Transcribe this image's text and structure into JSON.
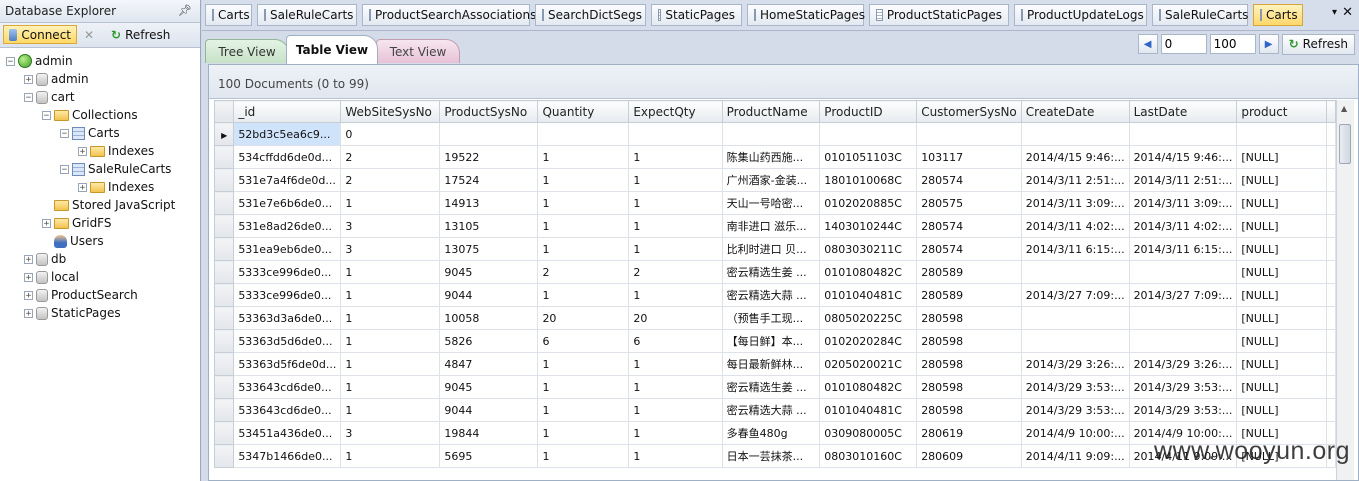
{
  "explorer": {
    "title": "Database Explorer",
    "connect_label": "Connect",
    "refresh_label": "Refresh",
    "tree": [
      {
        "label": "admin",
        "icon": "globe-icon",
        "level": 0,
        "expanded": true
      },
      {
        "label": "admin",
        "icon": "database-icon",
        "level": 1,
        "expanded": false
      },
      {
        "label": "cart",
        "icon": "database-icon",
        "level": 1,
        "expanded": true
      },
      {
        "label": "Collections",
        "icon": "folder-icon",
        "level": 2,
        "expanded": true
      },
      {
        "label": "Carts",
        "icon": "table-icon",
        "level": 3,
        "expanded": true
      },
      {
        "label": "Indexes",
        "icon": "folder-icon",
        "level": 4,
        "expanded": false
      },
      {
        "label": "SaleRuleCarts",
        "icon": "table-icon",
        "level": 3,
        "expanded": true
      },
      {
        "label": "Indexes",
        "icon": "folder-icon",
        "level": 4,
        "expanded": false
      },
      {
        "label": "Stored JavaScript",
        "icon": "folder-icon",
        "level": 2,
        "expanded": null
      },
      {
        "label": "GridFS",
        "icon": "folder-icon",
        "level": 2,
        "expanded": false
      },
      {
        "label": "Users",
        "icon": "user-icon",
        "level": 2,
        "expanded": null
      },
      {
        "label": "db",
        "icon": "database-icon",
        "level": 1,
        "expanded": false
      },
      {
        "label": "local",
        "icon": "database-icon",
        "level": 1,
        "expanded": false
      },
      {
        "label": "ProductSearch",
        "icon": "database-icon",
        "level": 1,
        "expanded": false
      },
      {
        "label": "StaticPages",
        "icon": "database-icon",
        "level": 1,
        "expanded": false
      }
    ]
  },
  "collection_tabs": [
    {
      "label": "Carts",
      "active": false
    },
    {
      "label": "SaleRuleCarts",
      "active": false
    },
    {
      "label": "ProductSearchAssociations",
      "active": false
    },
    {
      "label": "SearchDictSegs",
      "active": false
    },
    {
      "label": "StaticPages",
      "active": false
    },
    {
      "label": "HomeStaticPages",
      "active": false
    },
    {
      "label": "ProductStaticPages",
      "active": false
    },
    {
      "label": "ProductUpdateLogs",
      "active": false
    },
    {
      "label": "SaleRuleCarts",
      "active": false
    },
    {
      "label": "Carts",
      "active": true
    }
  ],
  "view_tabs": {
    "tree": "Tree View",
    "table": "Table View",
    "text": "Text View",
    "active": "table"
  },
  "pager": {
    "skip": "0",
    "limit": "100",
    "refresh_label": "Refresh"
  },
  "doc_count": "100 Documents (0 to 99)",
  "columns": [
    "_id",
    "WebSiteSysNo",
    "ProductSysNo",
    "Quantity",
    "ExpectQty",
    "ProductName",
    "ProductID",
    "CustomerSysNo",
    "CreateDate",
    "LastDate",
    "product"
  ],
  "rows": [
    [
      "52bd3c5ea6c9...",
      "0",
      "",
      "",
      "",
      "",
      "",
      "",
      "",
      "",
      ""
    ],
    [
      "534cffdd6de0d...",
      "2",
      "19522",
      "1",
      "1",
      "陈集山药西施...",
      "0101051103C",
      "103117",
      "2014/4/15 9:46:...",
      "2014/4/15 9:46:...",
      "[NULL]"
    ],
    [
      "531e7a4f6de0d...",
      "2",
      "17524",
      "1",
      "1",
      "广州酒家-金装...",
      "1801010068C",
      "280574",
      "2014/3/11 2:51:...",
      "2014/3/11 2:51:...",
      "[NULL]"
    ],
    [
      "531e7e6b6de0...",
      "1",
      "14913",
      "1",
      "1",
      "天山一号哈密...",
      "0102020885C",
      "280575",
      "2014/3/11 3:09:...",
      "2014/3/11 3:09:...",
      "[NULL]"
    ],
    [
      "531e8ad26de0...",
      "3",
      "13105",
      "1",
      "1",
      "南非进口 滋乐...",
      "1403010244C",
      "280574",
      "2014/3/11 4:02:...",
      "2014/3/11 4:02:...",
      "[NULL]"
    ],
    [
      "531ea9eb6de0...",
      "3",
      "13075",
      "1",
      "1",
      "比利时进口 贝...",
      "0803030211C",
      "280574",
      "2014/3/11 6:15:...",
      "2014/3/11 6:15:...",
      "[NULL]"
    ],
    [
      "5333ce996de0...",
      "1",
      "9045",
      "2",
      "2",
      "密云精选生姜 ...",
      "0101080482C",
      "280589",
      "",
      "",
      "[NULL]"
    ],
    [
      "5333ce996de0...",
      "1",
      "9044",
      "1",
      "1",
      "密云精选大蒜 ...",
      "0101040481C",
      "280589",
      "2014/3/27 7:09:...",
      "2014/3/27 7:09:...",
      "[NULL]"
    ],
    [
      "53363d3a6de0...",
      "1",
      "10058",
      "20",
      "20",
      "（预售手工现...",
      "0805020225C",
      "280598",
      "",
      "",
      "[NULL]"
    ],
    [
      "53363d5d6de0...",
      "1",
      "5826",
      "6",
      "6",
      "【每日鲜】本...",
      "0102020284C",
      "280598",
      "",
      "",
      "[NULL]"
    ],
    [
      "53363d5f6de0d...",
      "1",
      "4847",
      "1",
      "1",
      "每日最新鲜林...",
      "0205020021C",
      "280598",
      "2014/3/29 3:26:...",
      "2014/3/29 3:26:...",
      "[NULL]"
    ],
    [
      "533643cd6de0...",
      "1",
      "9045",
      "1",
      "1",
      "密云精选生姜 ...",
      "0101080482C",
      "280598",
      "2014/3/29 3:53:...",
      "2014/3/29 3:53:...",
      "[NULL]"
    ],
    [
      "533643cd6de0...",
      "1",
      "9044",
      "1",
      "1",
      "密云精选大蒜 ...",
      "0101040481C",
      "280598",
      "2014/3/29 3:53:...",
      "2014/3/29 3:53:...",
      "[NULL]"
    ],
    [
      "53451a436de0...",
      "3",
      "19844",
      "1",
      "1",
      "多春鱼480g",
      "0309080005C",
      "280619",
      "2014/4/9 10:00:...",
      "2014/4/9 10:00:...",
      "[NULL]"
    ],
    [
      "5347b1466de0...",
      "1",
      "5695",
      "1",
      "1",
      "日本一芸抹茶...",
      "0803010160C",
      "280609",
      "2014/4/11 9:09:...",
      "2014/4/11 9:09:...",
      "[NULL]"
    ]
  ],
  "watermark": "www.wooyun.org"
}
